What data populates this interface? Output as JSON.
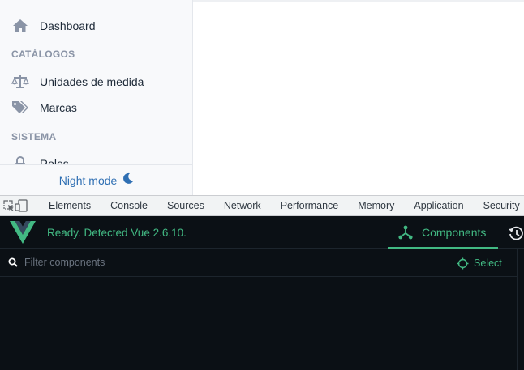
{
  "sidebar": {
    "items": [
      {
        "label": "Dashboard",
        "icon": "home-icon"
      },
      {
        "label": "Unidades de medida",
        "icon": "balance-scale-icon"
      },
      {
        "label": "Marcas",
        "icon": "tags-icon"
      },
      {
        "label": "Roles",
        "icon": "lock-icon"
      }
    ],
    "sections": [
      "CATÁLOGOS",
      "SISTEMA"
    ],
    "night_mode_label": "Night mode",
    "accent": "#2f6fb3"
  },
  "devtools": {
    "tabs": [
      "Elements",
      "Console",
      "Sources",
      "Network",
      "Performance",
      "Memory",
      "Application",
      "Security"
    ]
  },
  "vue": {
    "status": "Ready. Detected Vue 2.6.10.",
    "components_tab": "Components",
    "filter_placeholder": "Filter components",
    "select_label": "Select",
    "accent": "#42b983",
    "background": "#0b1015"
  }
}
